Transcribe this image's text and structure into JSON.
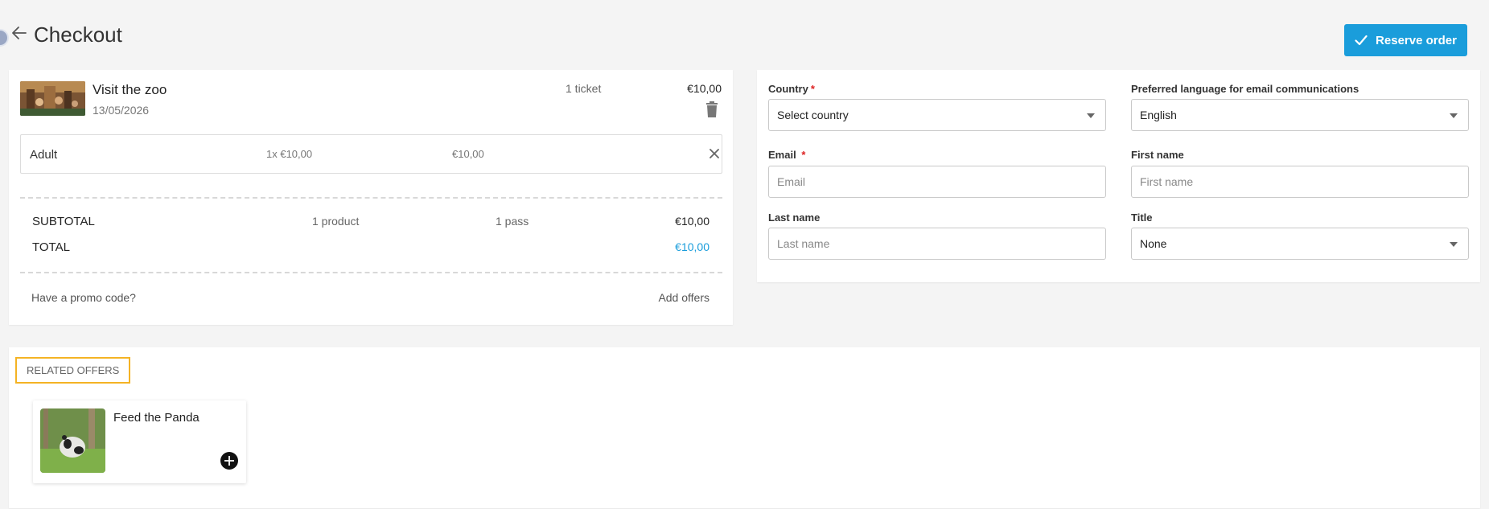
{
  "header": {
    "title": "Checkout",
    "reserve_label": "Reserve order"
  },
  "cart": {
    "product": {
      "name": "Visit the zoo",
      "date": "13/05/2026",
      "quantity": "1 ticket",
      "price": "€10,00"
    },
    "ticket": {
      "type": "Adult",
      "unit_price": "1x €10,00",
      "total": "€10,00"
    },
    "summary": {
      "subtotal_label": "SUBTOTAL",
      "products": "1 product",
      "passes": "1 pass",
      "subtotal_value": "€10,00",
      "total_label": "TOTAL",
      "total_value": "€10,00"
    },
    "promo_label": "Have a promo code?",
    "add_offers_label": "Add offers"
  },
  "form": {
    "country": {
      "label": "Country",
      "required_mark": "*",
      "value": "Select country"
    },
    "language": {
      "label": "Preferred language for email communications",
      "value": "English"
    },
    "email": {
      "label": "Email",
      "required_mark": "*",
      "placeholder": "Email"
    },
    "first_name": {
      "label": "First name",
      "placeholder": "First name"
    },
    "last_name": {
      "label": "Last name",
      "placeholder": "Last name"
    },
    "title": {
      "label": "Title",
      "value": "None"
    }
  },
  "related": {
    "heading": "RELATED OFFERS",
    "offers": [
      {
        "name": "Feed the Panda"
      }
    ]
  },
  "colors": {
    "accent": "#1a9ddb",
    "highlight_border": "#f4b324",
    "required": "#dd2222"
  },
  "icons": [
    "back-arrow-icon",
    "check-icon",
    "trash-icon",
    "close-icon",
    "chevron-down-icon",
    "plus-circle-icon"
  ]
}
